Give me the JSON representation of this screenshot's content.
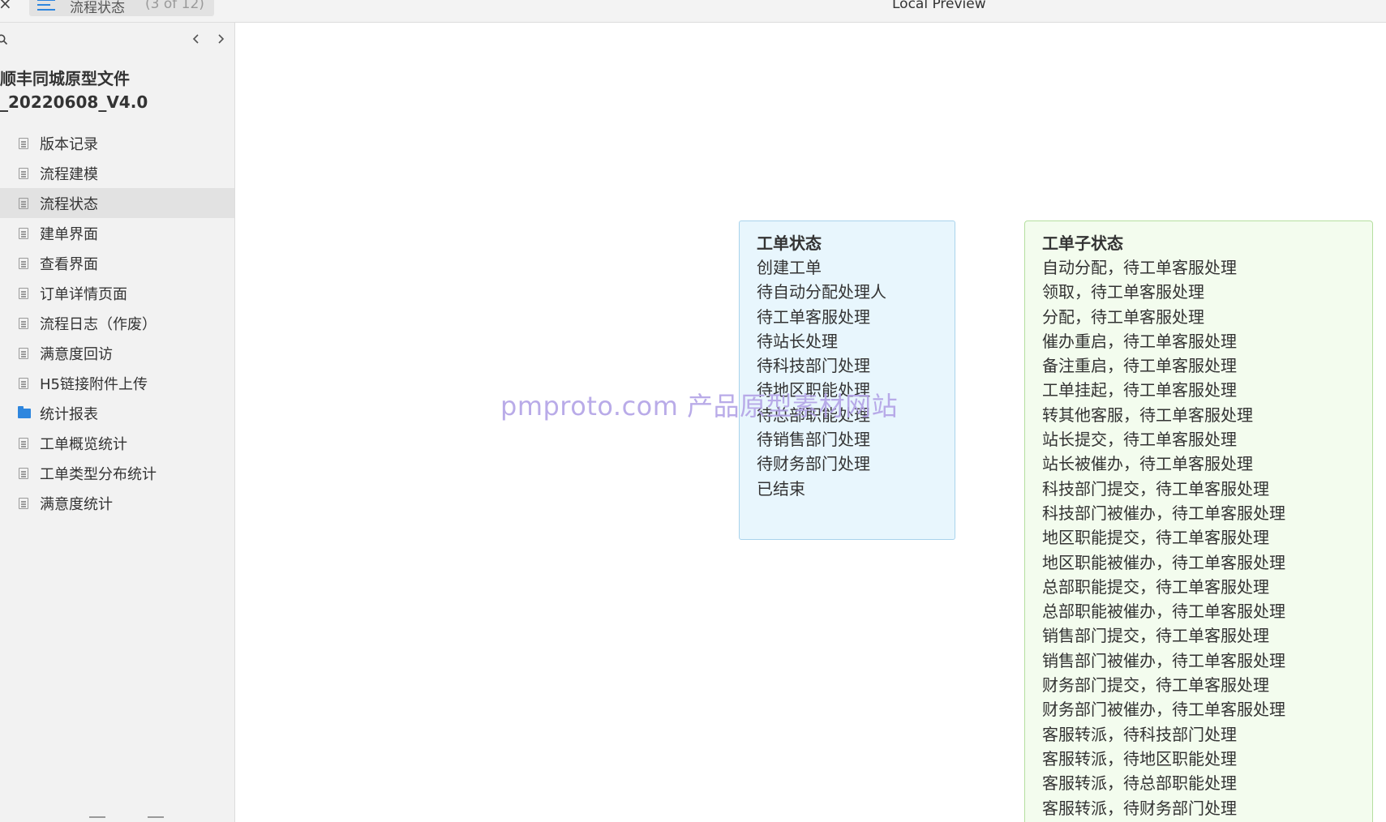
{
  "topbar": {
    "close_glyph": "×",
    "tab_title": "流程状态",
    "tab_count": "(3 of 12)",
    "preview_title": "Local Preview"
  },
  "sidebar": {
    "project_title_line1": "顺丰同城原型文件",
    "project_title_line2": "_20220608_V4.0",
    "items": [
      {
        "label": "版本记录",
        "icon": "page-icon",
        "selected": false
      },
      {
        "label": "流程建模",
        "icon": "page-icon",
        "selected": false
      },
      {
        "label": "流程状态",
        "icon": "page-icon",
        "selected": true
      },
      {
        "label": "建单界面",
        "icon": "page-icon",
        "selected": false
      },
      {
        "label": "查看界面",
        "icon": "page-icon",
        "selected": false
      },
      {
        "label": "订单详情页面",
        "icon": "page-icon",
        "selected": false
      },
      {
        "label": "流程日志（作废）",
        "icon": "page-icon",
        "selected": false
      },
      {
        "label": "满意度回访",
        "icon": "page-icon",
        "selected": false
      },
      {
        "label": "H5链接附件上传",
        "icon": "page-icon",
        "selected": false
      },
      {
        "label": "统计报表",
        "icon": "folder-icon",
        "selected": false
      },
      {
        "label": "工单概览统计",
        "icon": "page-icon",
        "selected": false
      },
      {
        "label": "工单类型分布统计",
        "icon": "page-icon",
        "selected": false
      },
      {
        "label": "满意度统计",
        "icon": "page-icon",
        "selected": false
      }
    ]
  },
  "canvas": {
    "status_box": {
      "heading": "工单状态",
      "lines": [
        "创建工单",
        "待自动分配处理人",
        "待工单客服处理",
        "待站长处理",
        "待科技部门处理",
        "待地区职能处理",
        "待总部职能处理",
        "待销售部门处理",
        "待财务部门处理",
        "已结束"
      ]
    },
    "substatus_box": {
      "heading": "工单子状态",
      "lines": [
        "自动分配，待工单客服处理",
        "领取，待工单客服处理",
        "分配，待工单客服处理",
        "催办重启，待工单客服处理",
        "备注重启，待工单客服处理",
        "工单挂起，待工单客服处理",
        "转其他客服，待工单客服处理",
        "站长提交，待工单客服处理",
        "站长被催办，待工单客服处理",
        "科技部门提交，待工单客服处理",
        "科技部门被催办，待工单客服处理",
        "地区职能提交，待工单客服处理",
        "地区职能被催办，待工单客服处理",
        "总部职能提交，待工单客服处理",
        "总部职能被催办，待工单客服处理",
        "销售部门提交，待工单客服处理",
        "销售部门被催办，待工单客服处理",
        "财务部门提交，待工单客服处理",
        "财务部门被催办，待工单客服处理",
        "客服转派，待科技部门处理",
        "客服转派，待地区职能处理",
        "客服转派，待总部职能处理",
        "客服转派，待财务部门处理"
      ]
    },
    "watermark": "pmproto.com 产品原型素材网站"
  },
  "colors": {
    "accent": "#2e86de",
    "status_box_bg": "#e8f6fd",
    "status_box_border": "#a9d3ec",
    "substatus_box_bg": "#f3fcee",
    "substatus_box_border": "#b5df9f",
    "watermark": "#b2a2e6"
  }
}
